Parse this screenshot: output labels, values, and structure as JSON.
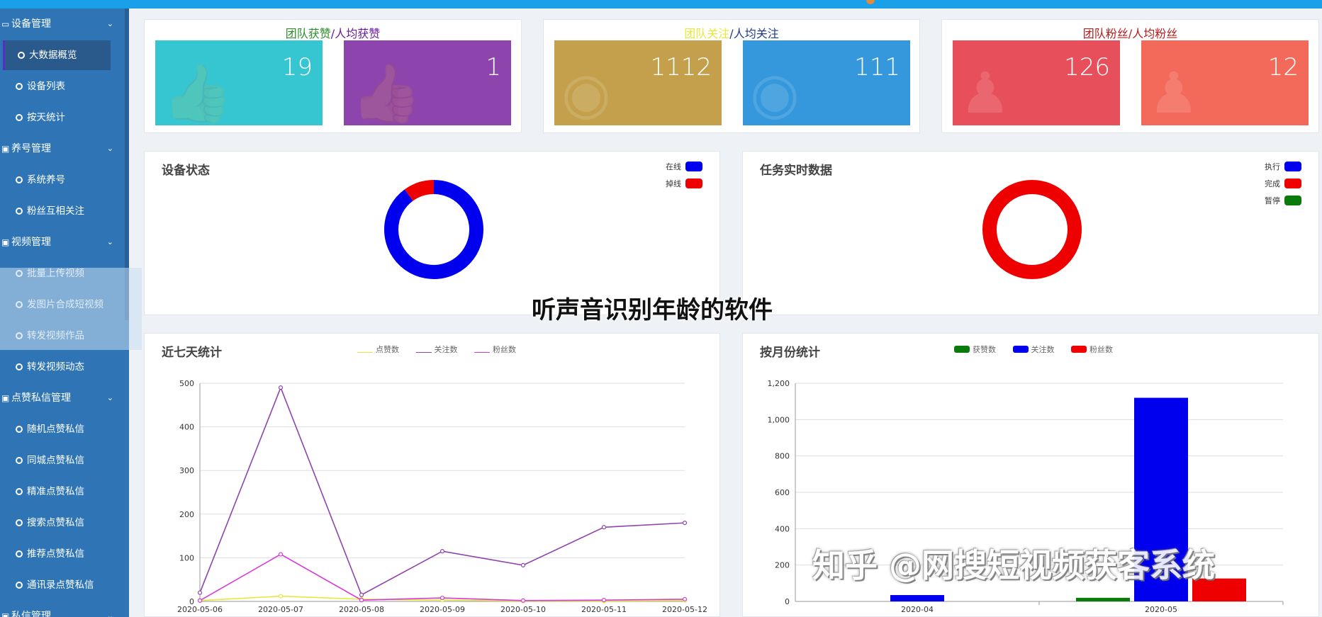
{
  "sidebar": {
    "groups": [
      {
        "label": "设备管理",
        "icon": "monitor-icon"
      },
      {
        "label": "养号管理",
        "icon": "gift-icon"
      },
      {
        "label": "视频管理",
        "icon": "gift-icon"
      },
      {
        "label": "点赞私信管理",
        "icon": "gift-icon"
      },
      {
        "label": "私信管理",
        "icon": "gift-icon"
      }
    ],
    "items": [
      {
        "label": "大数据概览",
        "active": true
      },
      {
        "label": "设备列表"
      },
      {
        "label": "按天统计"
      },
      {
        "label": "系统养号"
      },
      {
        "label": "粉丝互相关注"
      },
      {
        "label": "批量上传视频"
      },
      {
        "label": "发图片合成短视频"
      },
      {
        "label": "转发视频作品"
      },
      {
        "label": "转发视频动态"
      },
      {
        "label": "随机点赞私信"
      },
      {
        "label": "同城点赞私信"
      },
      {
        "label": "精准点赞私信"
      },
      {
        "label": "搜索点赞私信"
      },
      {
        "label": "推荐点赞私信"
      },
      {
        "label": "通讯录点赞私信"
      }
    ]
  },
  "stats": [
    {
      "title_a": "团队获赞",
      "sep": "/",
      "title_b": "人均获赞",
      "color_a": "#2e8b2e",
      "color_b": "#6a1b9a",
      "left_value": "19",
      "right_value": "1",
      "left_color": "#35c6d2",
      "right_color": "#8e44ad",
      "icon": "thumbs-up-icon"
    },
    {
      "title_a": "团队关注",
      "sep": "/",
      "title_b": "人均关注",
      "color_a": "#e8e83a",
      "color_b": "#1f3a8a",
      "left_value": "1112",
      "right_value": "111",
      "left_color": "#c4a04c",
      "right_color": "#3598dc",
      "icon": "eye-icon"
    },
    {
      "title_a": "团队粉丝",
      "sep": "/",
      "title_b": "人均粉丝",
      "color_a": "#b71c1c",
      "color_b": "#b71c1c",
      "left_value": "126",
      "right_value": "12",
      "left_color": "#e7505a",
      "right_color": "#f36a5a",
      "icon": "person-icon"
    }
  ],
  "device_status": {
    "title": "设备状态",
    "legend": [
      {
        "label": "在线",
        "color": "#0000ee"
      },
      {
        "label": "掉线",
        "color": "#ee0000"
      }
    ],
    "chart_data": {
      "type": "pie",
      "labels": [
        "在线",
        "掉线"
      ],
      "values": [
        90,
        10
      ],
      "colors": [
        "#0000ee",
        "#ee0000"
      ],
      "donut": true
    }
  },
  "task_status": {
    "title": "任务实时数据",
    "legend": [
      {
        "label": "执行",
        "color": "#0000ee"
      },
      {
        "label": "完成",
        "color": "#ee0000"
      },
      {
        "label": "暂停",
        "color": "#0a7a0a"
      }
    ],
    "chart_data": {
      "type": "pie",
      "labels": [
        "执行",
        "完成",
        "暂停"
      ],
      "values": [
        0,
        100,
        0
      ],
      "colors": [
        "#0000ee",
        "#ee0000",
        "#0a7a0a"
      ],
      "donut": true
    }
  },
  "seven_day": {
    "title": "近七天统计",
    "legend": [
      "点赞数",
      "关注数",
      "粉丝数"
    ],
    "chart_data": {
      "type": "line",
      "x": [
        "2020-05-06",
        "2020-05-07",
        "2020-05-08",
        "2020-05-09",
        "2020-05-10",
        "2020-05-11",
        "2020-05-12"
      ],
      "ylim": [
        0,
        500
      ],
      "yticks": [
        0,
        100,
        200,
        300,
        400,
        500
      ],
      "series": [
        {
          "name": "点赞数",
          "color": "#e8e83a",
          "values": [
            2,
            12,
            5,
            3,
            1,
            1,
            2
          ]
        },
        {
          "name": "关注数",
          "color": "#8e44ad",
          "values": [
            20,
            490,
            15,
            115,
            83,
            170,
            180
          ]
        },
        {
          "name": "粉丝数",
          "color": "#d63ad6",
          "values": [
            2,
            108,
            3,
            8,
            2,
            3,
            5
          ]
        }
      ]
    }
  },
  "monthly": {
    "title": "按月份统计",
    "legend": [
      "获赞数",
      "关注数",
      "粉丝数"
    ],
    "chart_data": {
      "type": "bar",
      "categories": [
        "2020-04",
        "2020-05"
      ],
      "ylim": [
        0,
        1200
      ],
      "yticks": [
        "0",
        "200",
        "400",
        "600",
        "800",
        "1,000",
        "1,200"
      ],
      "series": [
        {
          "name": "获赞数",
          "color": "#0a7a0a",
          "values": [
            0,
            20
          ]
        },
        {
          "name": "关注数",
          "color": "#0000ee",
          "values": [
            35,
            1120
          ]
        },
        {
          "name": "粉丝数",
          "color": "#ee0000",
          "values": [
            0,
            126
          ]
        }
      ]
    }
  },
  "overlay_text": "听声音识别年龄的软件",
  "watermark": "知乎 @网搜短视频获客系统"
}
